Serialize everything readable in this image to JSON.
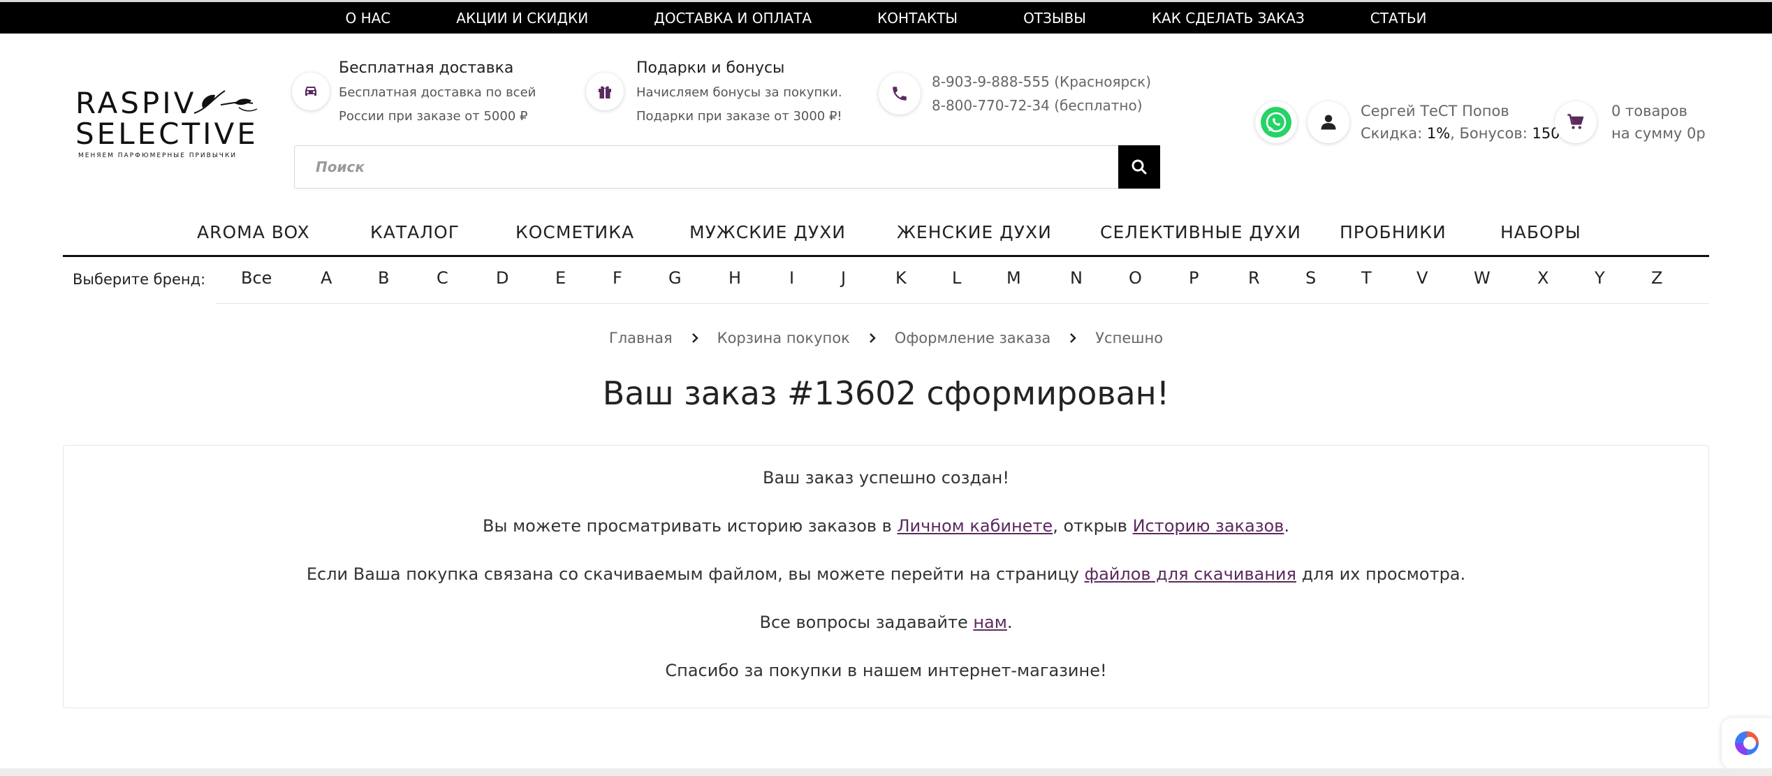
{
  "topnav": [
    "О НАС",
    "АКЦИИ И СКИДКИ",
    "ДОСТАВКА И ОПЛАТА",
    "КОНТАКТЫ",
    "ОТЗЫВЫ",
    "КАК СДЕЛАТЬ ЗАКАЗ",
    "СТАТЬИ"
  ],
  "logo": {
    "line1": "RASPIV",
    "line2": "SELECTIVE",
    "tagline": "МЕНЯЕМ ПАРФЮМЕРНЫЕ ПРИВЫЧКИ"
  },
  "delivery": {
    "title": "Бесплатная доставка",
    "line1": "Бесплатная доставка по всей",
    "line2": "России при заказе от 5000 ₽"
  },
  "gifts": {
    "title": "Подарки и бонусы",
    "line1": "Начисляем бонусы за покупки.",
    "line2": "Подарки при заказе от 3000 ₽!"
  },
  "phones": {
    "line1": "8-903-9-888-555 (Красноярск)",
    "line2": "8-800-770-72-34 (бесплатно)"
  },
  "search": {
    "placeholder": "Поиск"
  },
  "user": {
    "name": "Сергей ТеСТ Попов",
    "discount_label": "Скидка: ",
    "discount": "1%",
    "bonus_label": ", Бонусов: ",
    "bonus": "150"
  },
  "cart": {
    "line1": "0 товаров",
    "line2": "на сумму 0р"
  },
  "mainnav": [
    "AROMA BOX",
    "КАТАЛОГ",
    "КОСМЕТИКА",
    "МУЖСКИЕ ДУХИ",
    "ЖЕНСКИЕ ДУХИ",
    "СЕЛЕКТИВНЫЕ ДУХИ",
    "ПРОБНИКИ",
    "НАБОРЫ"
  ],
  "brands": {
    "label": "Выберите бренд:",
    "letters": [
      "Все",
      "A",
      "B",
      "C",
      "D",
      "E",
      "F",
      "G",
      "H",
      "I",
      "J",
      "K",
      "L",
      "M",
      "N",
      "O",
      "P",
      "R",
      "S",
      "T",
      "V",
      "W",
      "X",
      "Y",
      "Z"
    ]
  },
  "breadcrumb": [
    "Главная",
    "Корзина покупок",
    "Оформление заказа",
    "Успешно"
  ],
  "page_title": "Ваш заказ #13602 сформирован!",
  "message": {
    "p1": "Ваш заказ успешно создан!",
    "p2_a": "Вы можете просматривать историю заказов в ",
    "p2_link1": "Личном кабинете",
    "p2_b": ", открыв ",
    "p2_link2": "Историю заказов",
    "p2_c": ".",
    "p3_a": "Если Ваша покупка связана со скачиваемым файлом, вы можете перейти на страницу ",
    "p3_link": "файлов для скачивания",
    "p3_b": " для их просмотра.",
    "p4_a": "Все вопросы задавайте ",
    "p4_link": "нам",
    "p4_b": ".",
    "p5": "Спасибо за покупки в нашем интернет-магазине!"
  },
  "colors": {
    "accent": "#5b2a5e",
    "topbar": "#000000",
    "whatsapp": "#25d366"
  }
}
